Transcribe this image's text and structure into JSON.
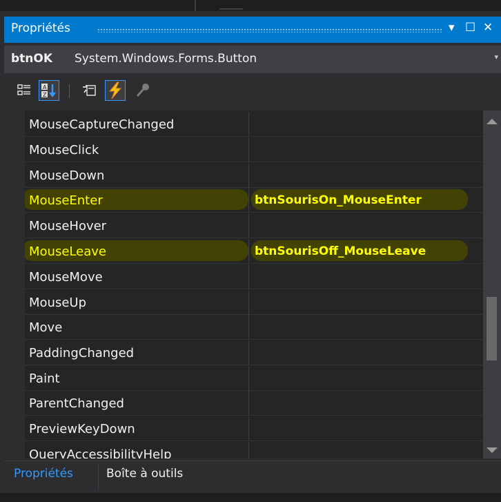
{
  "panel": {
    "title": "Propriétés",
    "buttons": {
      "dropdown": "▾",
      "maximize": "☐",
      "close": "✕"
    }
  },
  "object_selector": {
    "name": "btnOK",
    "type": "System.Windows.Forms.Button"
  },
  "toolbar": {
    "buttons": [
      "categorized-icon",
      "alphabetical-icon",
      "properties-icon",
      "events-icon",
      "property-pages-icon"
    ]
  },
  "grid": {
    "rows": [
      {
        "name": "MouseCaptureChanged",
        "value": ""
      },
      {
        "name": "MouseClick",
        "value": ""
      },
      {
        "name": "MouseDown",
        "value": ""
      },
      {
        "name": "MouseEnter",
        "value": "btnSourisOn_MouseEnter"
      },
      {
        "name": "MouseHover",
        "value": ""
      },
      {
        "name": "MouseLeave",
        "value": "btnSourisOff_MouseLeave"
      },
      {
        "name": "MouseMove",
        "value": ""
      },
      {
        "name": "MouseUp",
        "value": ""
      },
      {
        "name": "Move",
        "value": ""
      },
      {
        "name": "PaddingChanged",
        "value": ""
      },
      {
        "name": "Paint",
        "value": ""
      },
      {
        "name": "ParentChanged",
        "value": ""
      },
      {
        "name": "PreviewKeyDown",
        "value": ""
      },
      {
        "name": "QueryAccessibilityHelp",
        "value": ""
      }
    ]
  },
  "tabs": {
    "active": "Propriétés",
    "other": "Boîte à outils"
  },
  "colors": {
    "accent": "#007acc",
    "highlight_text": "#ffff00",
    "active_tab": "#3399ff"
  }
}
